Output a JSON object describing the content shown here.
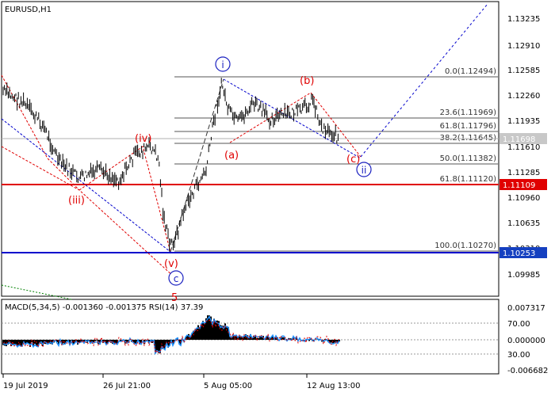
{
  "symbol": "EURUSD,H1",
  "indicator_label": "MACD(5,34,5) -0.001360 -0.001375 RSI(14) 37.39",
  "colors": {
    "background": "#ffffff",
    "candle": "#000000",
    "support_line": "#e00000",
    "support_label_bg": "#e00000",
    "price_line": "#b0b0b0",
    "price_label_bg": "#c8c8c8",
    "low_line": "#0000cc",
    "low_label_bg": "#1540c0",
    "wave_text": "#e00000",
    "wave_circle": "#1a20c0",
    "fib_line": "#555555",
    "macd_hist": "#000000",
    "macd_signal": "#1e90ff",
    "rsi": "#e00000",
    "wave_trend_up": "#0000cc",
    "wave_trend_down": "#e00000",
    "forecast": "#0000cc",
    "older_trend": "#008000"
  },
  "price_axis_labels": [
    "1.13235",
    "1.12910",
    "1.12585",
    "1.12260",
    "1.11935",
    "1.11610",
    "1.11285",
    "1.10960",
    "1.10635",
    "1.10310",
    "1.09985"
  ],
  "time_axis_labels": [
    "19 Jul 2019",
    "26 Jul 21:00",
    "5 Aug 05:00",
    "12 Aug 13:00"
  ],
  "indicator_axis_labels": [
    "0.007317",
    "70.00",
    "0.000000",
    "30.00",
    "-0.006682"
  ],
  "price_tags": {
    "current": "1.11698",
    "support": "1.11109",
    "low": "1.10253"
  },
  "fib_levels": [
    {
      "label": "0.0(1.12494)",
      "value": 1.12494
    },
    {
      "label": "23.6(1.11969)",
      "value": 1.11969
    },
    {
      "label": "61.8(1.11796)",
      "value": 1.11796
    },
    {
      "label": "38.2(1.11645)",
      "value": 1.11645
    },
    {
      "label": "50.0(1.11382)",
      "value": 1.11382
    },
    {
      "label": "61.8(1.11120)",
      "value": 1.1112
    },
    {
      "label": "100.0(1.10270)",
      "value": 1.1027
    }
  ],
  "wave_labels": {
    "iii": "(iii)",
    "iv": "(iv)",
    "v": "(v)",
    "a": "(a)",
    "b": "(b)",
    "c": "(c)",
    "five": "5"
  },
  "circle_labels": {
    "i": "i",
    "ii": "ii",
    "c": "c"
  }
}
